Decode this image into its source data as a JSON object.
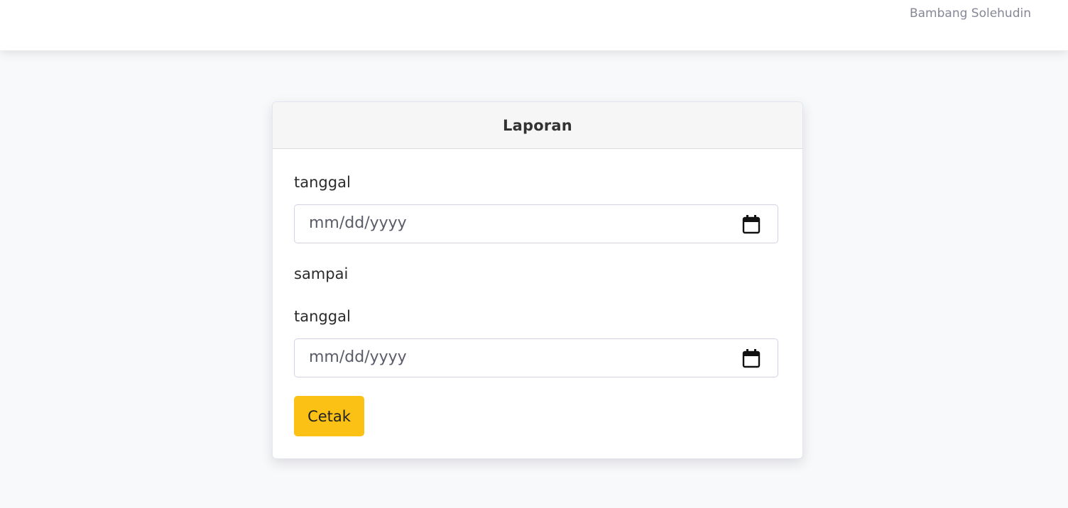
{
  "header": {
    "user_name": "Bambang Solehudin"
  },
  "card": {
    "title": "Laporan",
    "date_from": {
      "label": "tanggal",
      "placeholder": "mm/dd/yyyy"
    },
    "separator_label": "sampai",
    "date_to": {
      "label": "tanggal",
      "placeholder": "mm/dd/yyyy"
    },
    "submit_label": "Cetak"
  },
  "colors": {
    "page_background": "#f8f9fb",
    "button_accent": "#fbc115",
    "user_text": "#858796"
  },
  "icons": {
    "date_picker": "calendar-icon"
  }
}
